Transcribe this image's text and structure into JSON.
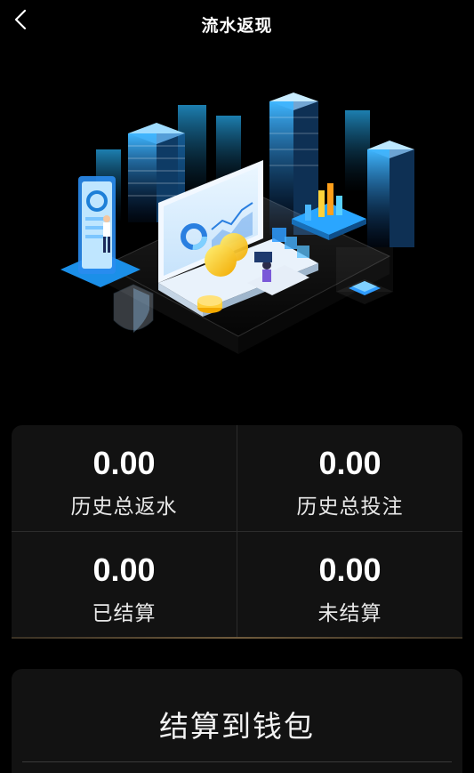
{
  "header": {
    "title": "流水返现",
    "back_icon": "chevron-left-icon"
  },
  "hero": {
    "illustration": "isometric-data-dashboard-illustration",
    "accent_color": "#2aa6ff"
  },
  "stats": [
    {
      "value": "0.00",
      "label": "历史总返水"
    },
    {
      "value": "0.00",
      "label": "历史总投注"
    },
    {
      "value": "0.00",
      "label": "已结算"
    },
    {
      "value": "0.00",
      "label": "未结算"
    }
  ],
  "settle": {
    "label": "结算到钱包"
  },
  "colors": {
    "background": "#000000",
    "card": "#121212",
    "divider": "#2c2c2c",
    "accent_line": "#6e5a3c"
  }
}
